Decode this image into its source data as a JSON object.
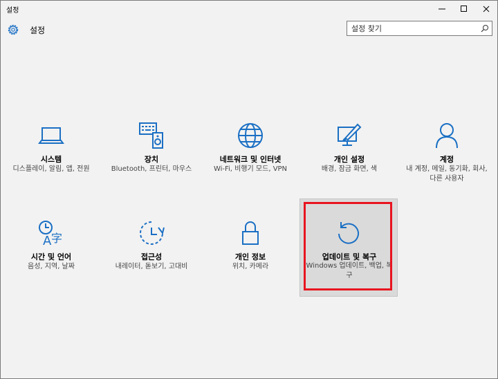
{
  "window": {
    "title": "설정"
  },
  "header": {
    "title": "설정"
  },
  "search": {
    "placeholder": "설정 찾기"
  },
  "tiles": [
    {
      "label": "시스템",
      "desc": "디스플레이, 알림, 앱, 전원",
      "icon": "laptop-icon"
    },
    {
      "label": "장치",
      "desc": "Bluetooth, 프린터, 마우스",
      "icon": "devices-icon"
    },
    {
      "label": "네트워크 및 인터넷",
      "desc": "Wi-Fi, 비행기 모드, VPN",
      "icon": "globe-icon"
    },
    {
      "label": "개인 설정",
      "desc": "배경, 잠금 화면, 색",
      "icon": "paint-icon"
    },
    {
      "label": "계정",
      "desc": "내 계정, 메일, 동기화, 회사, 다른 사용자",
      "icon": "person-icon"
    },
    {
      "label": "시간 및 언어",
      "desc": "음성, 지역, 날짜",
      "icon": "time-language-icon"
    },
    {
      "label": "접근성",
      "desc": "내레이터, 돋보기, 고대비",
      "icon": "ease-of-access-icon"
    },
    {
      "label": "개인 정보",
      "desc": "위치, 카메라",
      "icon": "lock-icon"
    },
    {
      "label": "업데이트 및 복구",
      "desc": "Windows 업데이트, 백업, 복구",
      "icon": "update-icon"
    }
  ],
  "colors": {
    "accent": "#1a6fc4",
    "highlight": "#e8141f",
    "background": "#f2f2f2"
  }
}
